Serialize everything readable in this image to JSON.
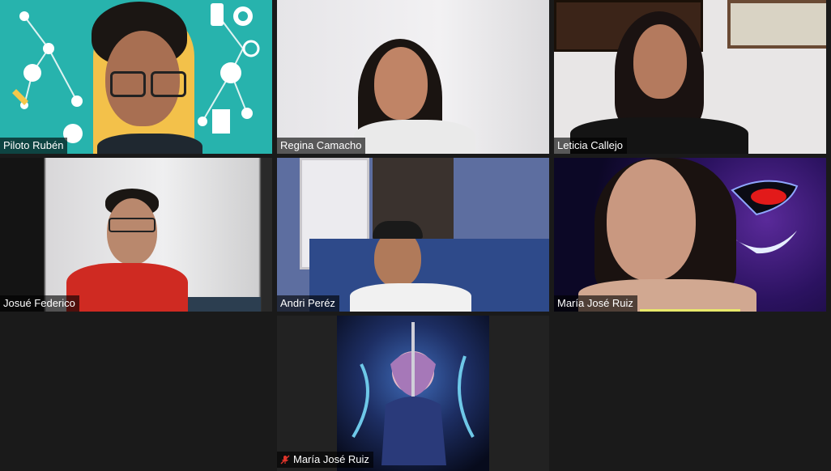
{
  "participants": [
    {
      "name": "Piloto Rubén",
      "muted": false,
      "active": false
    },
    {
      "name": "Regina Camacho",
      "muted": false,
      "active": true
    },
    {
      "name": "Leticia Callejo",
      "muted": false,
      "active": false
    },
    {
      "name": "Josué Federico",
      "muted": false,
      "active": false
    },
    {
      "name": "Andri Peréz",
      "muted": false,
      "active": false
    },
    {
      "name": "María José Ruiz",
      "muted": false,
      "active": false
    },
    {
      "name": "María José Ruiz",
      "muted": true,
      "active": false
    }
  ],
  "colors": {
    "active_border": "#b7e36a",
    "speaking_indicator": "#e8e86a",
    "mute_icon": "#e0352b"
  },
  "icons": {
    "mute": "muted-microphone-icon"
  }
}
